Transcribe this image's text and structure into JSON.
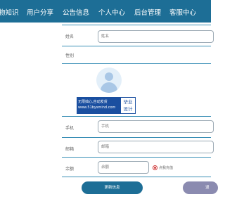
{
  "nav": {
    "items": [
      "物知识",
      "用户分享",
      "公告信息",
      "个人中心",
      "后台管理",
      "客服中心"
    ]
  },
  "form": {
    "name": {
      "label": "姓名",
      "placeholder": "姓名"
    },
    "gender": {
      "label": "性别"
    },
    "phone": {
      "label": "手机",
      "placeholder": "手机"
    },
    "email": {
      "label": "邮箱",
      "placeholder": "邮箱"
    },
    "balance": {
      "label": "余额",
      "placeholder": "余额",
      "recharge_label": "点我充值"
    }
  },
  "watermark": {
    "line1": "无限拙心,自动发货",
    "line2": "www.51bysmind.com",
    "right1": "毕业",
    "right2": "设计"
  },
  "buttons": {
    "update": "更新信息",
    "other": "退"
  },
  "colors": {
    "nav_bg": "#1d6e96",
    "accent": "#1d6e96",
    "separator": "#3a8fb6",
    "radio": "#d03a3a",
    "secondary_button": "#8b8bb0"
  }
}
